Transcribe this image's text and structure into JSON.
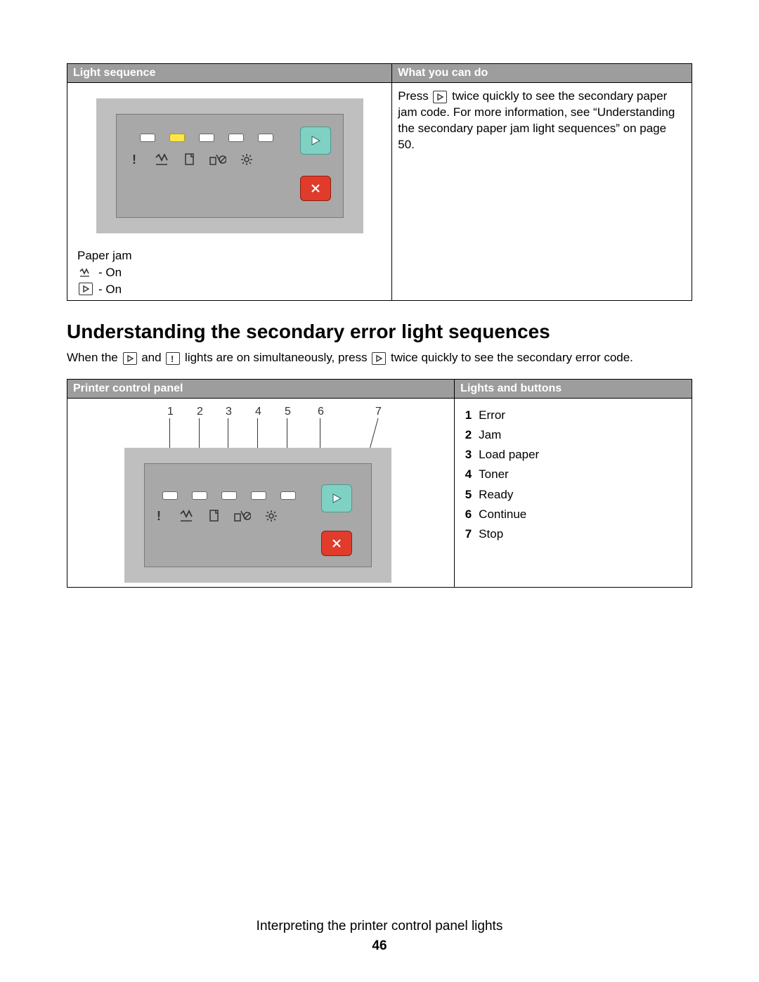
{
  "table1": {
    "header_left": "Light sequence",
    "header_right": "What you can do",
    "caption": "Paper jam",
    "state_jam": " - On",
    "state_cont": " - On",
    "right_text_a": "Press ",
    "right_text_b": " twice quickly to see the secondary paper jam code. For more information, see “Understanding the secondary paper jam light sequences” on page 50."
  },
  "section_heading": "Understanding the secondary error light sequences",
  "intro": {
    "a": "When the ",
    "b": " and ",
    "c": " lights are on simultaneously, press ",
    "d": " twice quickly to see the secondary error code."
  },
  "table2": {
    "header_left": "Printer control panel",
    "header_right": "Lights and buttons",
    "legend": [
      {
        "n": "1",
        "label": "Error"
      },
      {
        "n": "2",
        "label": "Jam"
      },
      {
        "n": "3",
        "label": "Load paper"
      },
      {
        "n": "4",
        "label": "Toner"
      },
      {
        "n": "5",
        "label": "Ready"
      },
      {
        "n": "6",
        "label": "Continue"
      },
      {
        "n": "7",
        "label": "Stop"
      }
    ],
    "callouts": [
      "1",
      "2",
      "3",
      "4",
      "5",
      "6",
      "7"
    ]
  },
  "footer": {
    "chapter": "Interpreting the printer control panel lights",
    "page": "46"
  }
}
